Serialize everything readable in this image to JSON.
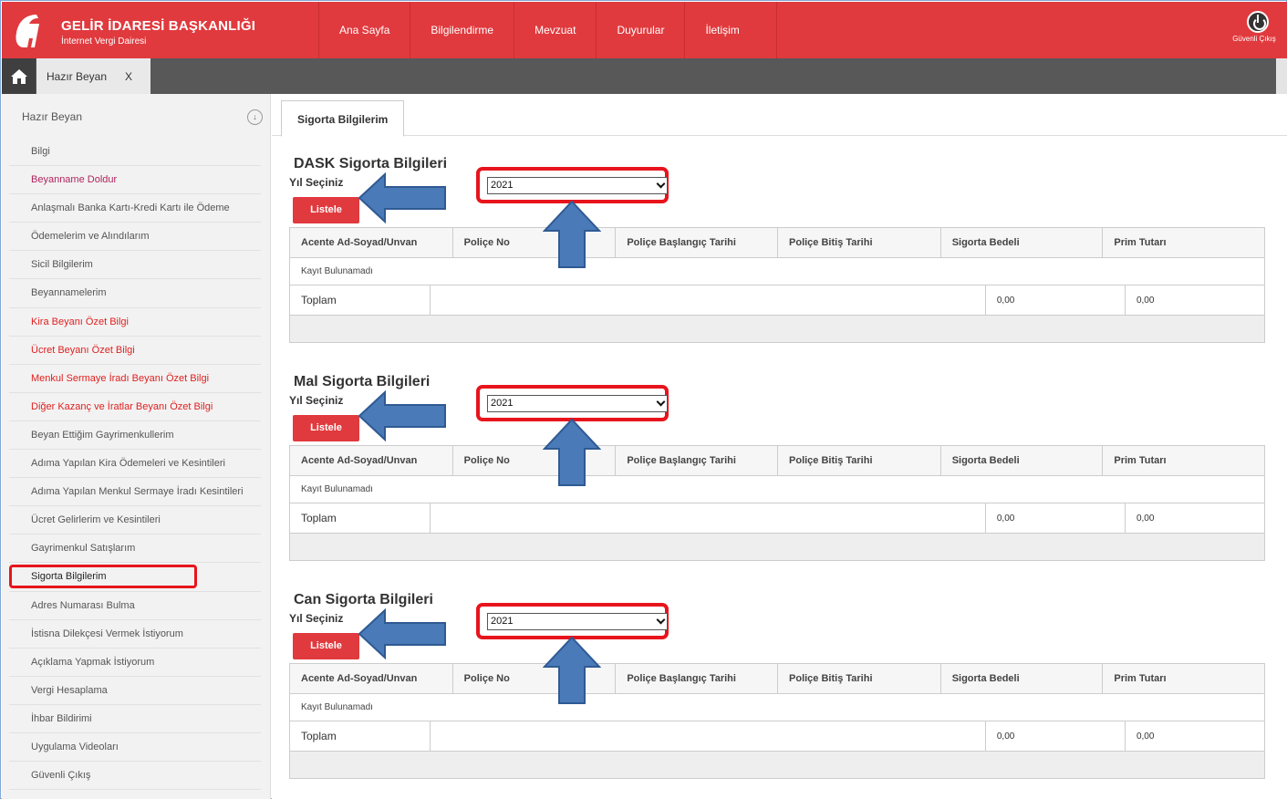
{
  "header": {
    "org_name": "GELİR İDARESİ BAŞKANLIĞI",
    "org_sub": "İnternet Vergi Dairesi",
    "nav": [
      "Ana Sayfa",
      "Bilgilendirme",
      "Mevzuat",
      "Duyurular",
      "İletişim"
    ],
    "logout_label": "Güvenli Çıkış",
    "brand_color": "#e03a3e"
  },
  "tabstrip": {
    "home_icon": "home-icon",
    "open_tab_label": "Hazır Beyan",
    "open_tab_close": "X"
  },
  "sidebar": {
    "title": "Hazır Beyan",
    "items": [
      {
        "label": "Bilgi",
        "style": "normal"
      },
      {
        "label": "Beyanname Doldur",
        "style": "pink"
      },
      {
        "label": "Anlaşmalı Banka Kartı-Kredi Kartı ile Ödeme",
        "style": "normal"
      },
      {
        "label": "Ödemelerim ve Alındılarım",
        "style": "normal"
      },
      {
        "label": "Sicil Bilgilerim",
        "style": "normal"
      },
      {
        "label": "Beyannamelerim",
        "style": "normal"
      },
      {
        "label": "Kira Beyanı Özet Bilgi",
        "style": "red"
      },
      {
        "label": "Ücret Beyanı Özet Bilgi",
        "style": "red"
      },
      {
        "label": "Menkul Sermaye İradı Beyanı Özet Bilgi",
        "style": "red"
      },
      {
        "label": "Diğer Kazanç ve İratlar Beyanı Özet Bilgi",
        "style": "red"
      },
      {
        "label": "Beyan Ettiğim Gayrimenkullerim",
        "style": "normal"
      },
      {
        "label": "Adıma Yapılan Kira Ödemeleri ve Kesintileri",
        "style": "normal"
      },
      {
        "label": "Adıma Yapılan Menkul Sermaye İradı Kesintileri",
        "style": "normal"
      },
      {
        "label": "Ücret Gelirlerim ve Kesintileri",
        "style": "normal"
      },
      {
        "label": "Gayrimenkul Satışlarım",
        "style": "normal"
      },
      {
        "label": "Sigorta Bilgilerim",
        "style": "active"
      },
      {
        "label": "Adres Numarası Bulma",
        "style": "normal"
      },
      {
        "label": "İstisna Dilekçesi Vermek İstiyorum",
        "style": "normal"
      },
      {
        "label": "Açıklama Yapmak İstiyorum",
        "style": "normal"
      },
      {
        "label": "Vergi Hesaplama",
        "style": "normal"
      },
      {
        "label": "İhbar Bildirimi",
        "style": "normal"
      },
      {
        "label": "Uygulama Videoları",
        "style": "normal"
      },
      {
        "label": "Güvenli Çıkış",
        "style": "normal"
      }
    ]
  },
  "main": {
    "tab_label": "Sigorta Bilgilerim",
    "year_label": "Yıl Seçiniz",
    "list_button": "Listele",
    "columns": [
      "Acente Ad-Soyad/Unvan",
      "Poliçe No",
      "Poliçe Başlangıç Tarihi",
      "Poliçe Bitiş Tarihi",
      "Sigorta Bedeli",
      "Prim Tutarı"
    ],
    "empty_text": "Kayıt Bulunamadı",
    "total_label": "Toplam",
    "sections": [
      {
        "title": "DASK Sigorta Bilgileri",
        "year": "2021",
        "total_bedel": "0,00",
        "total_prim": "0,00"
      },
      {
        "title": "Mal Sigorta Bilgileri",
        "year": "2021",
        "total_bedel": "0,00",
        "total_prim": "0,00"
      },
      {
        "title": "Can Sigorta Bilgileri",
        "year": "2021",
        "total_bedel": "0,00",
        "total_prim": "0,00"
      }
    ],
    "highlight_color": "#e8141c",
    "annotation_arrow_color": "#4a7ab8"
  }
}
